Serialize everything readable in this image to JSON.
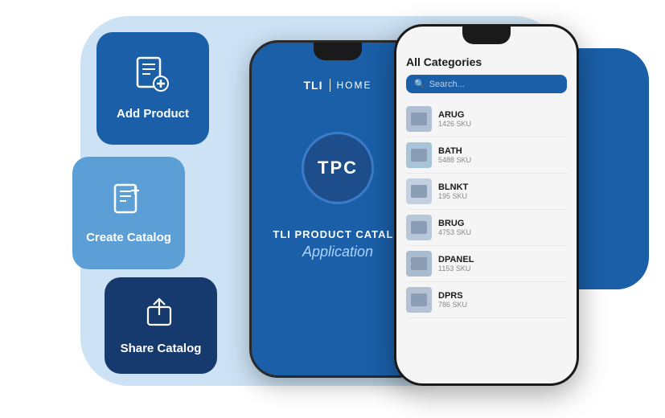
{
  "bg": {
    "color": "#cde3f5"
  },
  "buttons": {
    "add_product": {
      "label": "Add Product",
      "bg_color": "#1a5fa8"
    },
    "create_catalog": {
      "label": "Create Catalog",
      "bg_color": "#5b9fd6"
    },
    "share_catalog": {
      "label": "Share Catalog",
      "bg_color": "#163a6e"
    }
  },
  "phone_back": {
    "brand": "TLI",
    "separator": "|",
    "home": "HOME",
    "tpc_label": "TPC",
    "app_title": "TLI PRODUCT CATALO",
    "app_subtitle": "Application"
  },
  "phone_front": {
    "categories_title": "All Categories",
    "search_placeholder": "Search...",
    "categories": [
      {
        "name": "ARUG",
        "sku": "1426 SKU",
        "icon": "rug"
      },
      {
        "name": "BATH",
        "sku": "5488 SKU",
        "icon": "bath"
      },
      {
        "name": "BLNKT",
        "sku": "195 SKU",
        "icon": "blanket"
      },
      {
        "name": "BRUG",
        "sku": "4753 SKU",
        "icon": "brug"
      },
      {
        "name": "DPANEL",
        "sku": "1153 SKU",
        "icon": "panel"
      },
      {
        "name": "DPRS",
        "sku": "786 SKU",
        "icon": "dprs"
      }
    ]
  }
}
